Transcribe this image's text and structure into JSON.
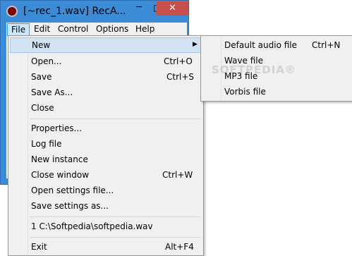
{
  "window": {
    "title": "[~rec_1.wav] RecA...",
    "minimize_glyph": "─",
    "maximize_glyph": "□",
    "close_glyph": "✕",
    "icon": "recorder-app-icon",
    "accent_color": "#3c8bd6",
    "close_color": "#c7504a"
  },
  "menubar": {
    "items": [
      {
        "label": "File"
      },
      {
        "label": "Edit"
      },
      {
        "label": "Control"
      },
      {
        "label": "Options"
      },
      {
        "label": "Help"
      }
    ]
  },
  "file_menu": {
    "items": [
      {
        "label": "New",
        "shortcut": "",
        "highlighted": true,
        "submenu_arrow": "▶"
      },
      {
        "label": "Open...",
        "shortcut": "Ctrl+O"
      },
      {
        "label": "Save",
        "shortcut": "Ctrl+S"
      },
      {
        "label": "Save As...",
        "shortcut": ""
      },
      {
        "label": "Close",
        "shortcut": ""
      },
      {
        "label": "Properties...",
        "shortcut": ""
      },
      {
        "label": "Log file",
        "shortcut": ""
      },
      {
        "label": "New instance",
        "shortcut": ""
      },
      {
        "label": "Close window",
        "shortcut": "Ctrl+W"
      },
      {
        "label": "Open settings file...",
        "shortcut": ""
      },
      {
        "label": "Save settings as...",
        "shortcut": ""
      },
      {
        "label": "1 C:\\Softpedia\\softpedia.wav",
        "shortcut": ""
      },
      {
        "label": "Exit",
        "shortcut": "Alt+F4"
      }
    ]
  },
  "new_submenu": {
    "items": [
      {
        "label": "Default audio file",
        "shortcut": "Ctrl+N"
      },
      {
        "label": "Wave file",
        "shortcut": ""
      },
      {
        "label": "MP3 file",
        "shortcut": ""
      },
      {
        "label": "Vorbis file",
        "shortcut": ""
      }
    ]
  },
  "watermark": "SOFTPEDIA®"
}
